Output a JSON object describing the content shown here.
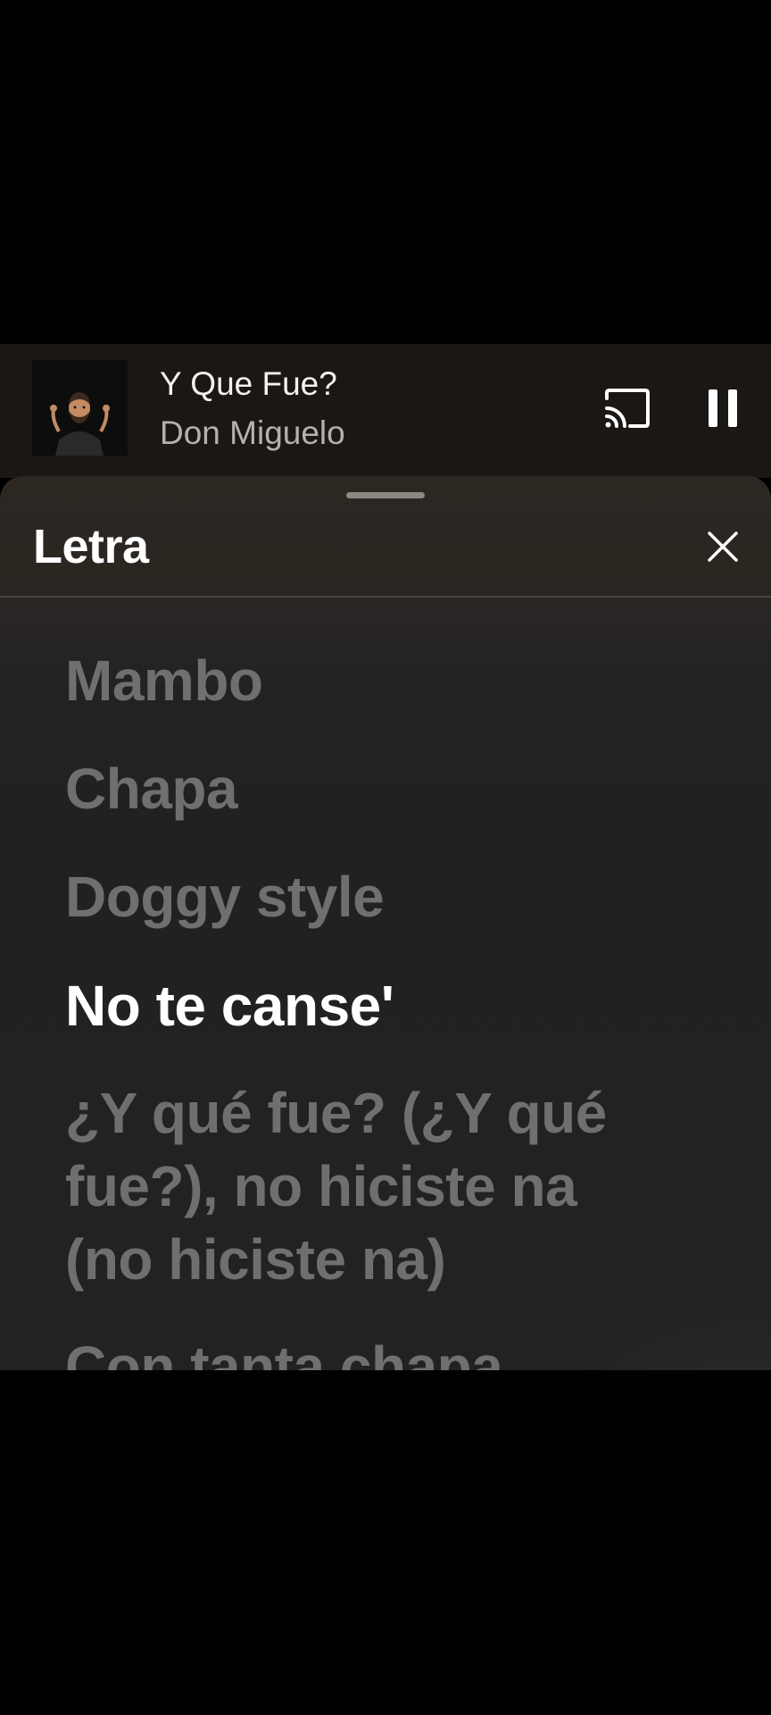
{
  "now_playing": {
    "title": "Y Que Fue?",
    "artist": "Don Miguelo",
    "album_art_icon": "memoji-shrug-avatar",
    "cast_icon": "cast-icon",
    "pause_icon": "pause-icon"
  },
  "lyrics_sheet": {
    "title": "Letra",
    "close_icon": "close-icon",
    "lines": [
      {
        "text": "Mambo",
        "active": false
      },
      {
        "text": "Chapa",
        "active": false
      },
      {
        "text": "Doggy style",
        "active": false
      },
      {
        "text": "No te canse'",
        "active": true
      },
      {
        "text": "¿Y qué fue? (¿Y qué",
        "active": false
      },
      {
        "text": "fue?), no hiciste na",
        "active": false
      },
      {
        "text": "(no hiciste na)",
        "active": false
      },
      {
        "text": "Con tanta chapa",
        "active": false
      }
    ]
  },
  "colors": {
    "background": "#000000",
    "mini_player_bg": "#1b1714",
    "sheet_header_bg": "#2d2722",
    "sheet_body_bg": "#222222",
    "active_lyric": "#ffffff",
    "inactive_lyric": "#6f6f6f",
    "artist_text": "#b5b1ac"
  }
}
